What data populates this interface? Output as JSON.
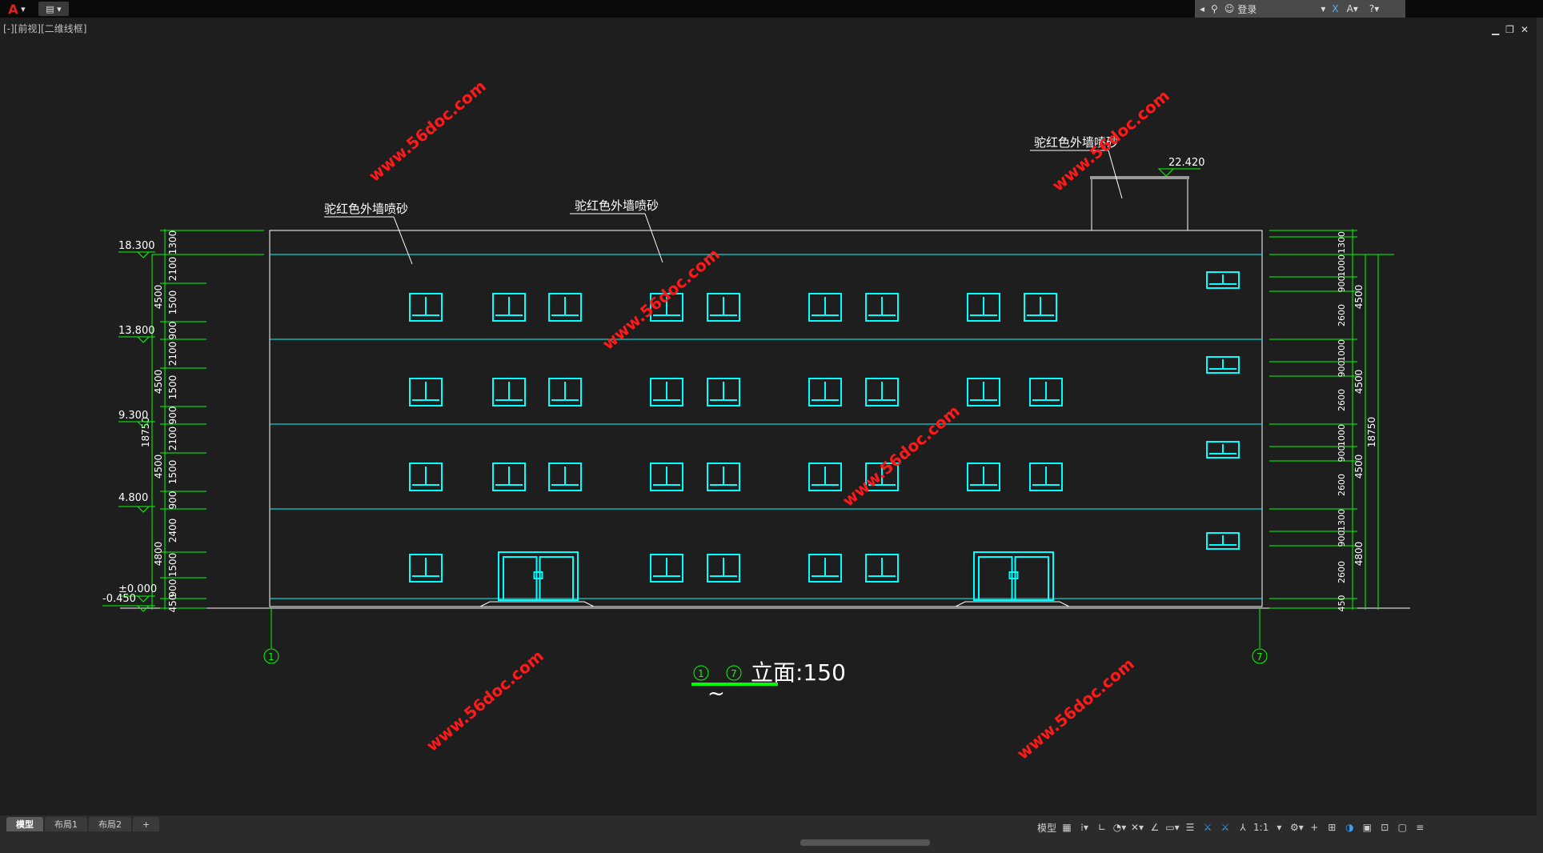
{
  "app": {
    "menu_icon": "autocad-logo-icon",
    "quick_access_icon": "document-icon"
  },
  "infocenter": {
    "login_label": "登录"
  },
  "viewport": {
    "label": "[-][前视][二维线框]"
  },
  "drawing": {
    "annotations": {
      "wall_label_1": "驼红色外墙喷砂",
      "wall_label_2": "驼红色外墙喷砂",
      "wall_label_3": "驼红色外墙喷砂"
    },
    "elevations": [
      "18.300",
      "13.800",
      "9.300",
      "4.800",
      "±0.000",
      "-0.450"
    ],
    "top_elevation": "22.420",
    "left_dims": [
      "1300",
      "2100",
      "1500",
      "900",
      "2100",
      "1500",
      "900",
      "2100",
      "1500",
      "900",
      "2400",
      "1500",
      "900",
      "450"
    ],
    "left_group_dims": [
      "4500",
      "4500",
      "4500",
      "4800"
    ],
    "total_dim": "18750",
    "right_dims": [
      "1300",
      "1000",
      "900",
      "2600",
      "1000",
      "900",
      "2600",
      "1000",
      "900",
      "2600",
      "1300",
      "900",
      "2600",
      "450"
    ],
    "right_group_dims": [
      "4500",
      "4500",
      "4500",
      "4800"
    ],
    "axis_left": "1",
    "axis_right": "7",
    "title_from": "1",
    "title_to": "7",
    "title_tilde": "~",
    "title_text": "立面:150",
    "watermark": "www.56doc.com"
  },
  "status": {
    "tabs": [
      {
        "label": "模型"
      },
      {
        "label": "布局1"
      },
      {
        "label": "布局2"
      },
      {
        "label": "+"
      }
    ],
    "model_label": "模型",
    "scale_label": "1:1"
  },
  "colors": {
    "line": "#00ffff",
    "dim": "#00ff00",
    "white": "#ffffff",
    "watermark": "#ff0000"
  }
}
